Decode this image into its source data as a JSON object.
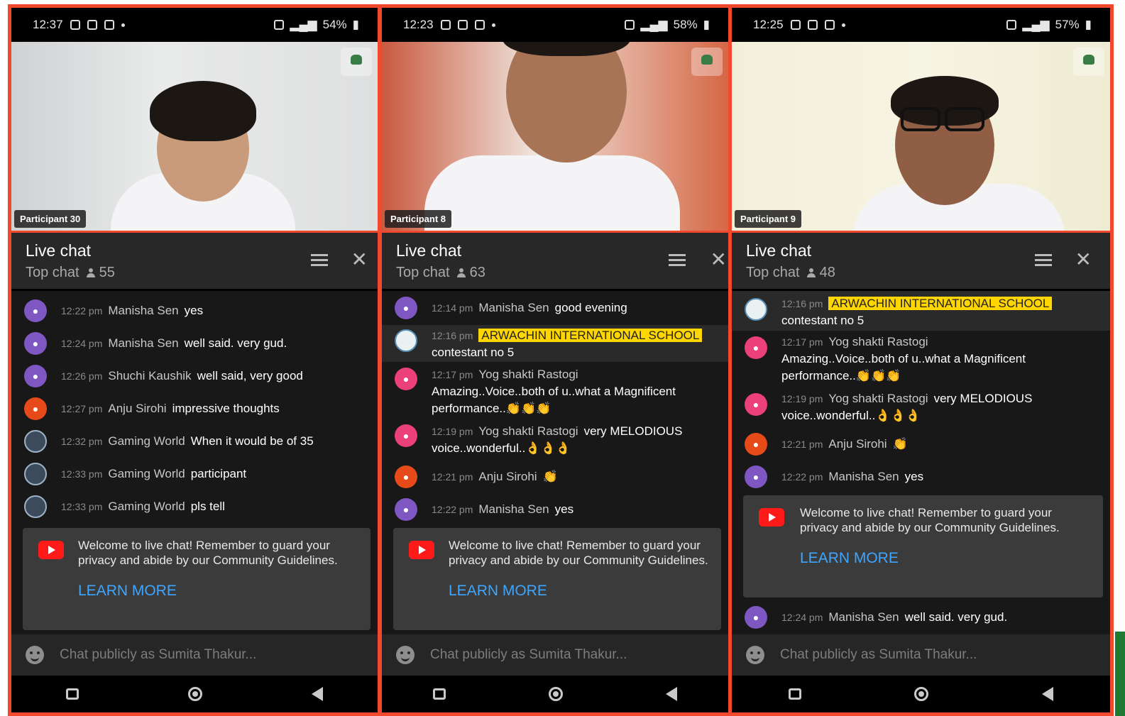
{
  "colors": {
    "frame": "#f2482e",
    "chat_bg": "#181818",
    "link": "#3ea6ff",
    "owner_badge": "#ffd600"
  },
  "phones": [
    {
      "status": {
        "time": "12:37",
        "battery": "54%"
      },
      "participant_label": "Participant 30",
      "chat": {
        "title": "Live chat",
        "mode": "Top chat",
        "viewers": "55"
      },
      "messages": [
        {
          "time": "12:22 pm",
          "author": "Manisha Sen",
          "text": "yes"
        },
        {
          "time": "12:24 pm",
          "author": "Manisha Sen",
          "text": "well said. very gud."
        },
        {
          "time": "12:26 pm",
          "author": "Shuchi Kaushik",
          "text": "well said, very good"
        },
        {
          "time": "12:27 pm",
          "author": "Anju Sirohi",
          "text": "impressive thoughts"
        },
        {
          "time": "12:32 pm",
          "author": "Gaming World",
          "text": "When it would be of 35"
        },
        {
          "time": "12:33 pm",
          "author": "Gaming World",
          "text": "participant"
        },
        {
          "time": "12:33 pm",
          "author": "Gaming World",
          "text": "pls tell"
        }
      ],
      "welcome": {
        "text": "Welcome to live chat! Remember to guard your privacy and abide by our Community Guidelines.",
        "link": "LEARN MORE"
      },
      "input_placeholder": "Chat publicly as Sumita Thakur..."
    },
    {
      "status": {
        "time": "12:23",
        "battery": "58%"
      },
      "participant_label": "Participant 8",
      "chat": {
        "title": "Live chat",
        "mode": "Top chat",
        "viewers": "63"
      },
      "messages": [
        {
          "time": "12:14 pm",
          "author": "Manisha Sen",
          "text": "good evening"
        },
        {
          "time": "12:16 pm",
          "author": "ARWACHIN INTERNATIONAL SCHOOL",
          "text": "contestant no 5"
        },
        {
          "time": "12:17 pm",
          "author": "Yog shakti Rastogi",
          "text": "Amazing..Voice..both of u..what a Magnificent performance..",
          "emoji": "👏👏👏"
        },
        {
          "time": "12:19 pm",
          "author": "Yog shakti Rastogi",
          "text": "very MELODIOUS voice..wonderful..",
          "emoji": "👌👌👌"
        },
        {
          "time": "12:21 pm",
          "author": "Anju Sirohi",
          "text": "",
          "emoji": "👏"
        },
        {
          "time": "12:22 pm",
          "author": "Manisha Sen",
          "text": "yes"
        }
      ],
      "welcome": {
        "text": "Welcome to live chat! Remember to guard your privacy and abide by our Community Guidelines.",
        "link": "LEARN MORE"
      },
      "input_placeholder": "Chat publicly as Sumita Thakur..."
    },
    {
      "status": {
        "time": "12:25",
        "battery": "57%"
      },
      "participant_label": "Participant 9",
      "chat": {
        "title": "Live chat",
        "mode": "Top chat",
        "viewers": "48"
      },
      "messages": [
        {
          "time": "12:16 pm",
          "author": "ARWACHIN INTERNATIONAL SCHOOL",
          "text": "contestant no 5"
        },
        {
          "time": "12:17 pm",
          "author": "Yog shakti Rastogi",
          "text": "Amazing..Voice..both of u..what a Magnificent performance..",
          "emoji": "👏👏👏"
        },
        {
          "time": "12:19 pm",
          "author": "Yog shakti Rastogi",
          "text": "very MELODIOUS voice..wonderful..",
          "emoji": "👌👌👌"
        },
        {
          "time": "12:21 pm",
          "author": "Anju Sirohi",
          "text": "",
          "emoji": "👏"
        },
        {
          "time": "12:22 pm",
          "author": "Manisha Sen",
          "text": "yes"
        },
        {
          "time": "12:24 pm",
          "author": "Manisha Sen",
          "text": "well said. very gud."
        }
      ],
      "welcome": {
        "text": "Welcome to live chat! Remember to guard your privacy and abide by our Community Guidelines.",
        "link": "LEARN MORE"
      },
      "input_placeholder": "Chat publicly as Sumita Thakur..."
    }
  ]
}
